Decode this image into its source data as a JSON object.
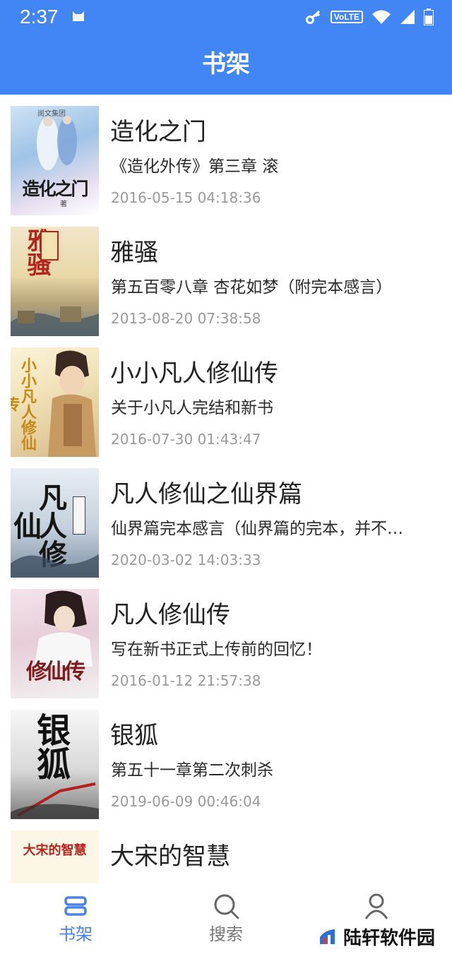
{
  "status_bar": {
    "time": "2:37",
    "volte": "VoLTE",
    "icons": [
      "cat-icon",
      "key-icon",
      "volte-icon",
      "wifi-icon",
      "signal-icon",
      "battery-icon"
    ]
  },
  "app_bar": {
    "title": "书架"
  },
  "books": [
    {
      "title": "造化之门",
      "chapter": "《造化外传》第三章 滚",
      "time": "2016-05-15 04:18:36",
      "cover_text": "造化之门"
    },
    {
      "title": "雅骚",
      "chapter": "第五百零八章 杏花如梦（附完本感言）",
      "time": "2013-08-20 07:38:58",
      "cover_text": "雅骚"
    },
    {
      "title": "小小凡人修仙传",
      "chapter": "关于小凡人完结和新书",
      "time": "2016-07-30 01:43:47",
      "cover_text": "小小凡人修仙传"
    },
    {
      "title": "凡人修仙之仙界篇",
      "chapter": "仙界篇完本感言（仙界篇的完本，并不…",
      "time": "2020-03-02 14:03:33",
      "cover_text": "凡人修仙"
    },
    {
      "title": "凡人修仙传",
      "chapter": "写在新书正式上传前的回忆！",
      "time": "2016-01-12 21:57:38",
      "cover_text": "修仙传"
    },
    {
      "title": "银狐",
      "chapter": "第五十一章第二次刺杀",
      "time": "2019-06-09 00:46:04",
      "cover_text": "银狐"
    },
    {
      "title": "大宋的智慧",
      "chapter": "",
      "time": "",
      "cover_text": "大宋的智慧"
    }
  ],
  "tabs": [
    {
      "label": "书架",
      "icon": "bookshelf-icon",
      "active": true
    },
    {
      "label": "搜索",
      "icon": "search-icon",
      "active": false
    },
    {
      "label": "",
      "icon": "profile-icon",
      "active": false
    }
  ],
  "watermark": {
    "text": "陆轩软件园"
  },
  "colors": {
    "primary": "#4285f4",
    "tab_active": "#4a82ec",
    "tab_inactive": "#777777",
    "time_text": "#9a9a9a"
  }
}
